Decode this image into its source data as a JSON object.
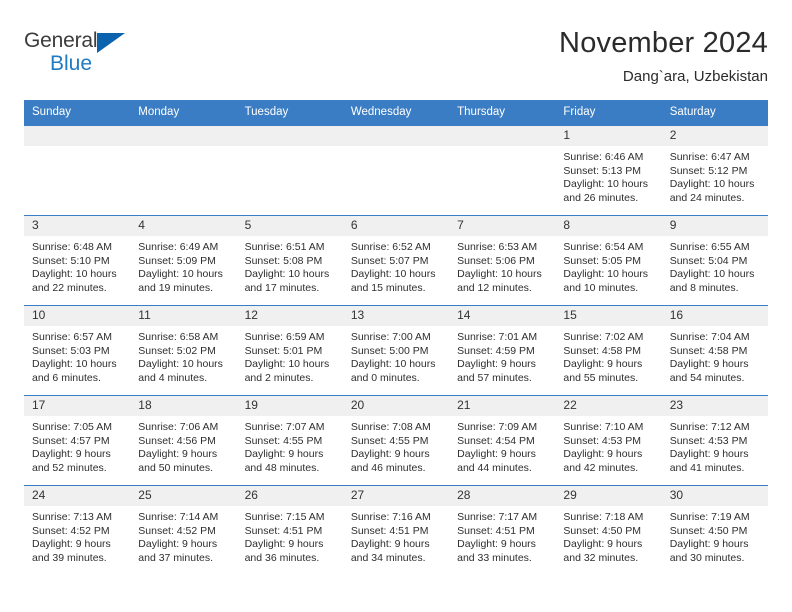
{
  "logo": {
    "word1": "General",
    "word2": "Blue",
    "triangle_color": "#0b63ad",
    "word2_color": "#1e7bc4"
  },
  "header": {
    "title": "November 2024",
    "subtitle": "Dang`ara, Uzbekistan"
  },
  "colors": {
    "header_row_bg": "#3b7dc4",
    "header_row_text": "#ffffff",
    "daynum_bg": "#f0f0f0",
    "row_divider": "#3b7dc4"
  },
  "weekdays": [
    "Sunday",
    "Monday",
    "Tuesday",
    "Wednesday",
    "Thursday",
    "Friday",
    "Saturday"
  ],
  "weeks": [
    [
      {
        "day": "",
        "sunrise": "",
        "sunset": "",
        "daylight1": "",
        "daylight2": "",
        "empty": true
      },
      {
        "day": "",
        "sunrise": "",
        "sunset": "",
        "daylight1": "",
        "daylight2": "",
        "empty": true
      },
      {
        "day": "",
        "sunrise": "",
        "sunset": "",
        "daylight1": "",
        "daylight2": "",
        "empty": true
      },
      {
        "day": "",
        "sunrise": "",
        "sunset": "",
        "daylight1": "",
        "daylight2": "",
        "empty": true
      },
      {
        "day": "",
        "sunrise": "",
        "sunset": "",
        "daylight1": "",
        "daylight2": "",
        "empty": true
      },
      {
        "day": "1",
        "sunrise": "Sunrise: 6:46 AM",
        "sunset": "Sunset: 5:13 PM",
        "daylight1": "Daylight: 10 hours",
        "daylight2": "and 26 minutes.",
        "empty": false
      },
      {
        "day": "2",
        "sunrise": "Sunrise: 6:47 AM",
        "sunset": "Sunset: 5:12 PM",
        "daylight1": "Daylight: 10 hours",
        "daylight2": "and 24 minutes.",
        "empty": false
      }
    ],
    [
      {
        "day": "3",
        "sunrise": "Sunrise: 6:48 AM",
        "sunset": "Sunset: 5:10 PM",
        "daylight1": "Daylight: 10 hours",
        "daylight2": "and 22 minutes.",
        "empty": false
      },
      {
        "day": "4",
        "sunrise": "Sunrise: 6:49 AM",
        "sunset": "Sunset: 5:09 PM",
        "daylight1": "Daylight: 10 hours",
        "daylight2": "and 19 minutes.",
        "empty": false
      },
      {
        "day": "5",
        "sunrise": "Sunrise: 6:51 AM",
        "sunset": "Sunset: 5:08 PM",
        "daylight1": "Daylight: 10 hours",
        "daylight2": "and 17 minutes.",
        "empty": false
      },
      {
        "day": "6",
        "sunrise": "Sunrise: 6:52 AM",
        "sunset": "Sunset: 5:07 PM",
        "daylight1": "Daylight: 10 hours",
        "daylight2": "and 15 minutes.",
        "empty": false
      },
      {
        "day": "7",
        "sunrise": "Sunrise: 6:53 AM",
        "sunset": "Sunset: 5:06 PM",
        "daylight1": "Daylight: 10 hours",
        "daylight2": "and 12 minutes.",
        "empty": false
      },
      {
        "day": "8",
        "sunrise": "Sunrise: 6:54 AM",
        "sunset": "Sunset: 5:05 PM",
        "daylight1": "Daylight: 10 hours",
        "daylight2": "and 10 minutes.",
        "empty": false
      },
      {
        "day": "9",
        "sunrise": "Sunrise: 6:55 AM",
        "sunset": "Sunset: 5:04 PM",
        "daylight1": "Daylight: 10 hours",
        "daylight2": "and 8 minutes.",
        "empty": false
      }
    ],
    [
      {
        "day": "10",
        "sunrise": "Sunrise: 6:57 AM",
        "sunset": "Sunset: 5:03 PM",
        "daylight1": "Daylight: 10 hours",
        "daylight2": "and 6 minutes.",
        "empty": false
      },
      {
        "day": "11",
        "sunrise": "Sunrise: 6:58 AM",
        "sunset": "Sunset: 5:02 PM",
        "daylight1": "Daylight: 10 hours",
        "daylight2": "and 4 minutes.",
        "empty": false
      },
      {
        "day": "12",
        "sunrise": "Sunrise: 6:59 AM",
        "sunset": "Sunset: 5:01 PM",
        "daylight1": "Daylight: 10 hours",
        "daylight2": "and 2 minutes.",
        "empty": false
      },
      {
        "day": "13",
        "sunrise": "Sunrise: 7:00 AM",
        "sunset": "Sunset: 5:00 PM",
        "daylight1": "Daylight: 10 hours",
        "daylight2": "and 0 minutes.",
        "empty": false
      },
      {
        "day": "14",
        "sunrise": "Sunrise: 7:01 AM",
        "sunset": "Sunset: 4:59 PM",
        "daylight1": "Daylight: 9 hours",
        "daylight2": "and 57 minutes.",
        "empty": false
      },
      {
        "day": "15",
        "sunrise": "Sunrise: 7:02 AM",
        "sunset": "Sunset: 4:58 PM",
        "daylight1": "Daylight: 9 hours",
        "daylight2": "and 55 minutes.",
        "empty": false
      },
      {
        "day": "16",
        "sunrise": "Sunrise: 7:04 AM",
        "sunset": "Sunset: 4:58 PM",
        "daylight1": "Daylight: 9 hours",
        "daylight2": "and 54 minutes.",
        "empty": false
      }
    ],
    [
      {
        "day": "17",
        "sunrise": "Sunrise: 7:05 AM",
        "sunset": "Sunset: 4:57 PM",
        "daylight1": "Daylight: 9 hours",
        "daylight2": "and 52 minutes.",
        "empty": false
      },
      {
        "day": "18",
        "sunrise": "Sunrise: 7:06 AM",
        "sunset": "Sunset: 4:56 PM",
        "daylight1": "Daylight: 9 hours",
        "daylight2": "and 50 minutes.",
        "empty": false
      },
      {
        "day": "19",
        "sunrise": "Sunrise: 7:07 AM",
        "sunset": "Sunset: 4:55 PM",
        "daylight1": "Daylight: 9 hours",
        "daylight2": "and 48 minutes.",
        "empty": false
      },
      {
        "day": "20",
        "sunrise": "Sunrise: 7:08 AM",
        "sunset": "Sunset: 4:55 PM",
        "daylight1": "Daylight: 9 hours",
        "daylight2": "and 46 minutes.",
        "empty": false
      },
      {
        "day": "21",
        "sunrise": "Sunrise: 7:09 AM",
        "sunset": "Sunset: 4:54 PM",
        "daylight1": "Daylight: 9 hours",
        "daylight2": "and 44 minutes.",
        "empty": false
      },
      {
        "day": "22",
        "sunrise": "Sunrise: 7:10 AM",
        "sunset": "Sunset: 4:53 PM",
        "daylight1": "Daylight: 9 hours",
        "daylight2": "and 42 minutes.",
        "empty": false
      },
      {
        "day": "23",
        "sunrise": "Sunrise: 7:12 AM",
        "sunset": "Sunset: 4:53 PM",
        "daylight1": "Daylight: 9 hours",
        "daylight2": "and 41 minutes.",
        "empty": false
      }
    ],
    [
      {
        "day": "24",
        "sunrise": "Sunrise: 7:13 AM",
        "sunset": "Sunset: 4:52 PM",
        "daylight1": "Daylight: 9 hours",
        "daylight2": "and 39 minutes.",
        "empty": false
      },
      {
        "day": "25",
        "sunrise": "Sunrise: 7:14 AM",
        "sunset": "Sunset: 4:52 PM",
        "daylight1": "Daylight: 9 hours",
        "daylight2": "and 37 minutes.",
        "empty": false
      },
      {
        "day": "26",
        "sunrise": "Sunrise: 7:15 AM",
        "sunset": "Sunset: 4:51 PM",
        "daylight1": "Daylight: 9 hours",
        "daylight2": "and 36 minutes.",
        "empty": false
      },
      {
        "day": "27",
        "sunrise": "Sunrise: 7:16 AM",
        "sunset": "Sunset: 4:51 PM",
        "daylight1": "Daylight: 9 hours",
        "daylight2": "and 34 minutes.",
        "empty": false
      },
      {
        "day": "28",
        "sunrise": "Sunrise: 7:17 AM",
        "sunset": "Sunset: 4:51 PM",
        "daylight1": "Daylight: 9 hours",
        "daylight2": "and 33 minutes.",
        "empty": false
      },
      {
        "day": "29",
        "sunrise": "Sunrise: 7:18 AM",
        "sunset": "Sunset: 4:50 PM",
        "daylight1": "Daylight: 9 hours",
        "daylight2": "and 32 minutes.",
        "empty": false
      },
      {
        "day": "30",
        "sunrise": "Sunrise: 7:19 AM",
        "sunset": "Sunset: 4:50 PM",
        "daylight1": "Daylight: 9 hours",
        "daylight2": "and 30 minutes.",
        "empty": false
      }
    ]
  ]
}
